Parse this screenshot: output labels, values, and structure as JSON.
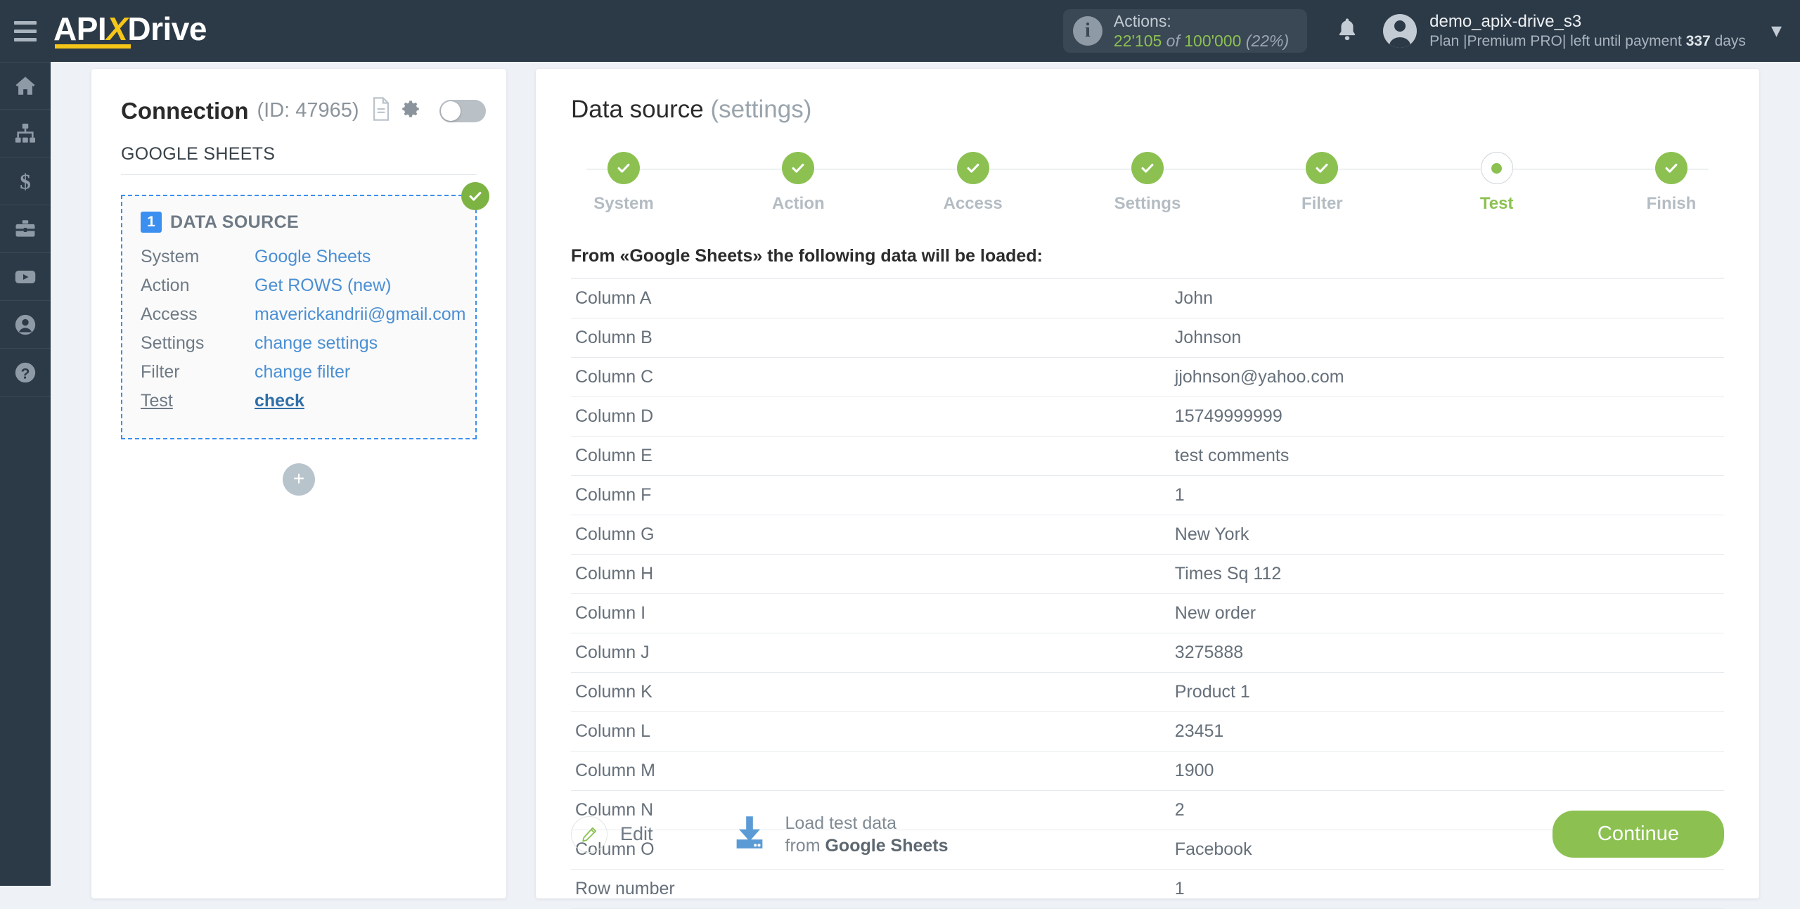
{
  "topbar": {
    "logo": {
      "part1": "API",
      "x": "X",
      "part2": "Drive"
    },
    "menu_icon": "hamburger-icon",
    "actions": {
      "label": "Actions:",
      "used": "22'105",
      "of": "of",
      "total": "100'000",
      "percent": "(22%)"
    },
    "user": {
      "name": "demo_apix-drive_s3",
      "plan_prefix": "Plan |Premium PRO| left until payment ",
      "plan_days": "337",
      "plan_suffix": " days"
    }
  },
  "rail": {
    "items": [
      {
        "name": "home",
        "icon": "home-icon"
      },
      {
        "name": "connections",
        "icon": "sitemap-icon"
      },
      {
        "name": "billing",
        "icon": "dollar-icon"
      },
      {
        "name": "business",
        "icon": "briefcase-icon"
      },
      {
        "name": "video",
        "icon": "youtube-icon"
      },
      {
        "name": "account",
        "icon": "user-icon"
      },
      {
        "name": "help",
        "icon": "question-icon"
      }
    ]
  },
  "connection": {
    "title": "Connection",
    "id_text": "(ID: 47965)",
    "system_label": "GOOGLE SHEETS",
    "block": {
      "number": "1",
      "title": "DATA SOURCE",
      "rows": [
        {
          "key": "System",
          "value": "Google Sheets"
        },
        {
          "key": "Action",
          "value": "Get ROWS (new)"
        },
        {
          "key": "Access",
          "value": "maverickandrii@gmail.com"
        },
        {
          "key": "Settings",
          "value": "change settings"
        },
        {
          "key": "Filter",
          "value": "change filter"
        },
        {
          "key": "Test",
          "value": "check"
        }
      ]
    },
    "add_label": "+"
  },
  "main": {
    "title": "Data source",
    "title_muted": "(settings)",
    "steps": [
      {
        "label": "System",
        "state": "done"
      },
      {
        "label": "Action",
        "state": "done"
      },
      {
        "label": "Access",
        "state": "done"
      },
      {
        "label": "Settings",
        "state": "done"
      },
      {
        "label": "Filter",
        "state": "done"
      },
      {
        "label": "Test",
        "state": "current"
      },
      {
        "label": "Finish",
        "state": "done"
      }
    ],
    "table_caption": "From «Google Sheets» the following data will be loaded:",
    "table": [
      {
        "field": "Column A",
        "value": "John"
      },
      {
        "field": "Column B",
        "value": "Johnson"
      },
      {
        "field": "Column C",
        "value": "jjohnson@yahoo.com"
      },
      {
        "field": "Column D",
        "value": "15749999999"
      },
      {
        "field": "Column E",
        "value": "test comments"
      },
      {
        "field": "Column F",
        "value": "1"
      },
      {
        "field": "Column G",
        "value": "New York"
      },
      {
        "field": "Column H",
        "value": "Times Sq 112"
      },
      {
        "field": "Column I",
        "value": "New order"
      },
      {
        "field": "Column J",
        "value": "3275888"
      },
      {
        "field": "Column K",
        "value": "Product 1"
      },
      {
        "field": "Column L",
        "value": "23451"
      },
      {
        "field": "Column M",
        "value": "1900"
      },
      {
        "field": "Column N",
        "value": "2"
      },
      {
        "field": "Column O",
        "value": "Facebook"
      },
      {
        "field": "Row number",
        "value": "1"
      }
    ],
    "edit_label": "Edit",
    "load_line1": "Load test data",
    "load_line2_prefix": "from ",
    "load_line2_bold": "Google Sheets",
    "continue_label": "Continue"
  },
  "colors": {
    "header_bg": "#2c3a47",
    "accent_yellow": "#f5c518",
    "green": "#8cc152",
    "blue": "#3b8ff0",
    "page_bg": "#eef1f6"
  }
}
